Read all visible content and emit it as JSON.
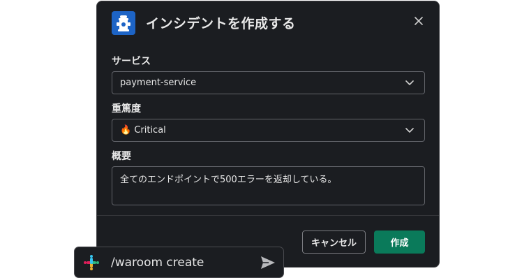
{
  "modal": {
    "title": "インシデントを作成する",
    "service": {
      "label": "サービス",
      "value": "payment-service"
    },
    "severity": {
      "label": "重篤度",
      "value": "🔥 Critical"
    },
    "summary": {
      "label": "概要",
      "value": "全てのエンドポイントで500エラーを返却している。"
    },
    "cancel_label": "キャンセル",
    "create_label": "作成"
  },
  "composer": {
    "command": "/waroom create"
  },
  "colors": {
    "background": "#1b1d21",
    "accent_blue": "#1d64c6",
    "primary_green": "#0a7a5a",
    "border": "#62646a"
  },
  "icons": {
    "header": "fire-hydrant-icon",
    "close": "close-icon",
    "dropdown": "chevron-down-icon",
    "app": "slack-logo-icon",
    "send": "send-icon"
  }
}
